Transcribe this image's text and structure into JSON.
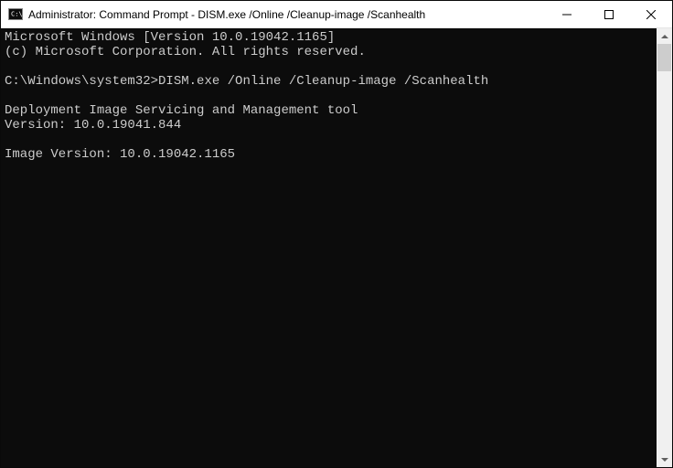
{
  "titlebar": {
    "title": "Administrator: Command Prompt - DISM.exe  /Online /Cleanup-image /Scanhealth"
  },
  "console": {
    "line1": "Microsoft Windows [Version 10.0.19042.1165]",
    "line2": "(c) Microsoft Corporation. All rights reserved.",
    "blank1": "",
    "prompt_path": "C:\\Windows\\system32>",
    "prompt_cmd": "DISM.exe /Online /Cleanup-image /Scanhealth",
    "blank2": "",
    "dism1": "Deployment Image Servicing and Management tool",
    "dism2": "Version: 10.0.19041.844",
    "blank3": "",
    "imgver": "Image Version: 10.0.19042.1165"
  }
}
